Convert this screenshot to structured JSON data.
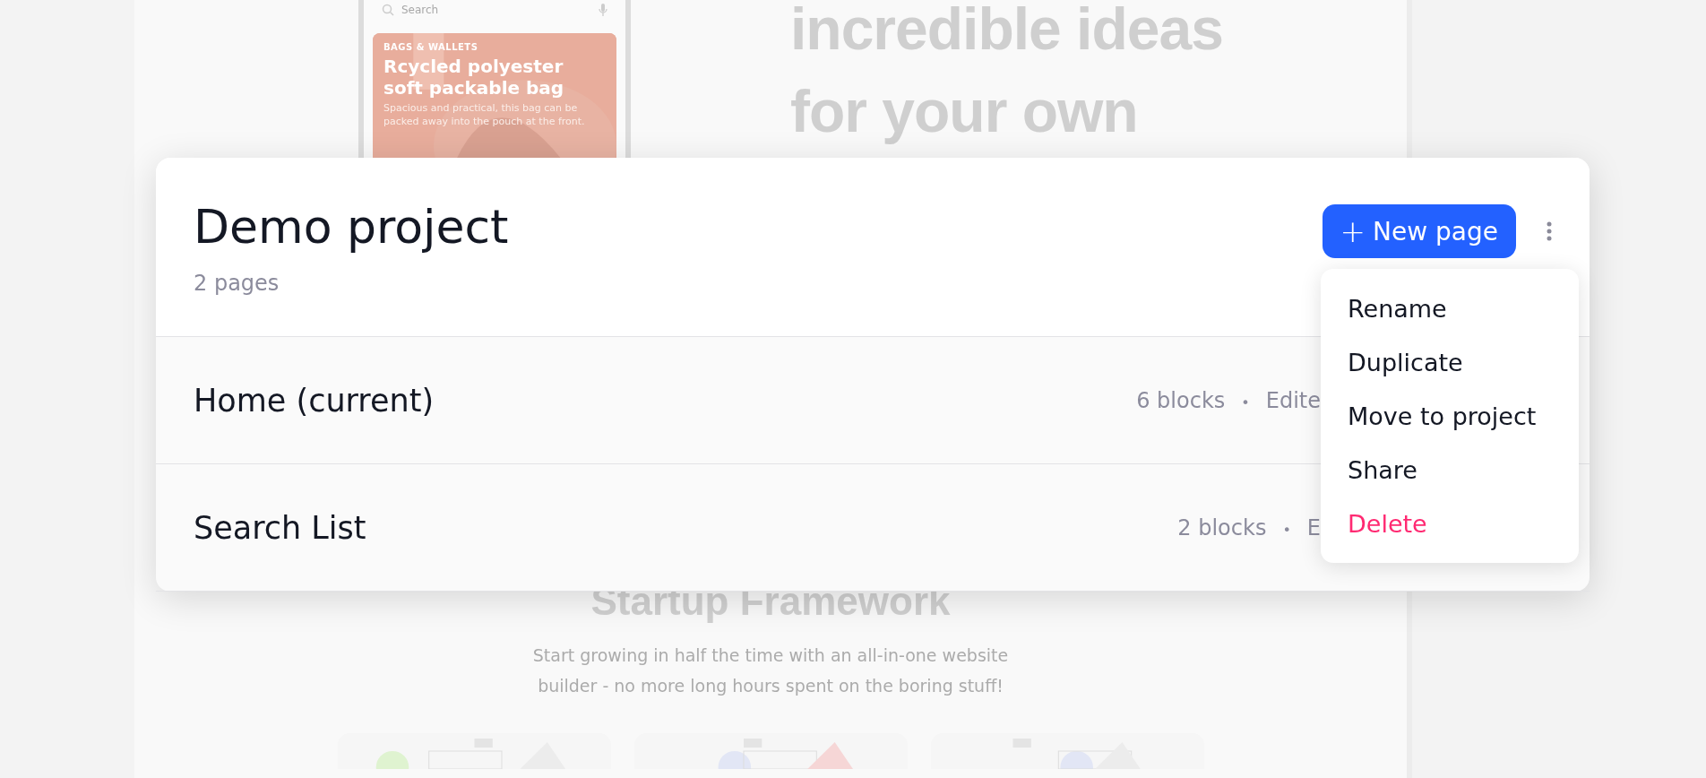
{
  "background": {
    "phone": {
      "search_placeholder": "Search",
      "card": {
        "category": "BAGS & WALLETS",
        "title": "Rcycled polyester soft packable bag",
        "description": "Spacious and practical, this bag can be packed away into the pouch at the front."
      }
    },
    "headline": [
      "incredible ideas",
      "for your own"
    ],
    "section_title": "Startup Framework",
    "section_text": "Start growing in half the time with an all-in-one website builder - no more long hours spent on the boring stuff!",
    "feature_cards": [
      {
        "kind": "picture"
      },
      {
        "kind": "picture"
      },
      {
        "kind": "picture"
      }
    ]
  },
  "project": {
    "title": "Demo project",
    "subtitle": "2 pages",
    "new_button": {
      "icon": "+",
      "label": "New page"
    },
    "pages": [
      {
        "name": "Home (current)",
        "blocks": "6 blocks",
        "separator": "•",
        "edited": "Edite"
      },
      {
        "name": "Search List",
        "blocks": "2 blocks",
        "separator": "•",
        "edited": "E"
      }
    ],
    "menu": [
      {
        "label": "Rename",
        "kind": "normal"
      },
      {
        "label": "Duplicate",
        "kind": "normal"
      },
      {
        "label": "Move to project",
        "kind": "normal"
      },
      {
        "label": "Share",
        "kind": "normal"
      },
      {
        "label": "Delete",
        "kind": "danger"
      }
    ]
  }
}
